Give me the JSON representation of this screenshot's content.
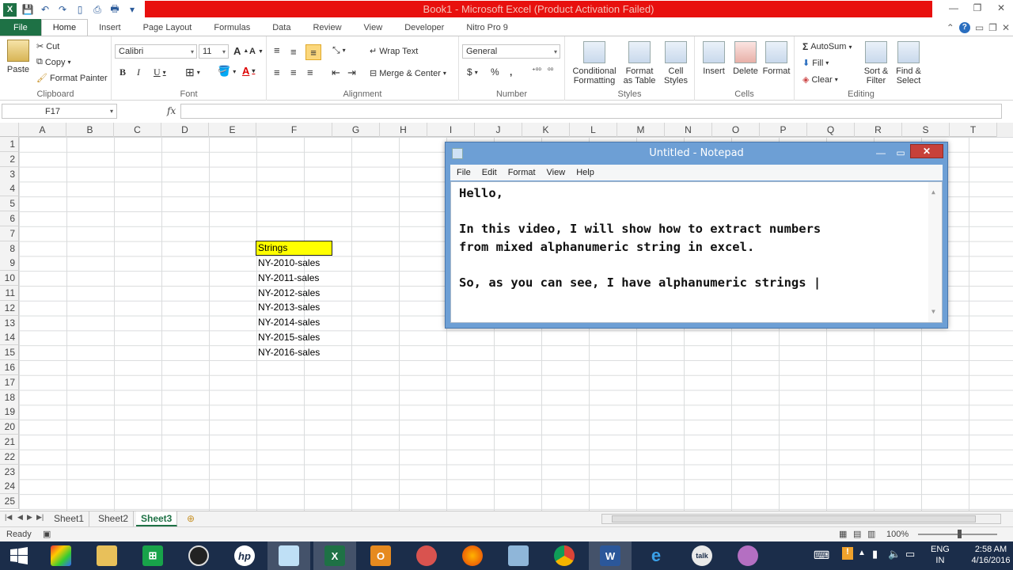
{
  "window": {
    "title": "Book1 - Microsoft Excel (Product Activation Failed)"
  },
  "ribbon_tabs": [
    "File",
    "Home",
    "Insert",
    "Page Layout",
    "Formulas",
    "Data",
    "Review",
    "View",
    "Developer",
    "Nitro Pro 9"
  ],
  "clipboard": {
    "paste": "Paste",
    "cut": "Cut",
    "copy": "Copy",
    "format_painter": "Format Painter",
    "label": "Clipboard"
  },
  "font": {
    "name": "Calibri",
    "size": "11",
    "label": "Font"
  },
  "alignment": {
    "wrap_text": "Wrap Text",
    "merge_center": "Merge & Center",
    "label": "Alignment"
  },
  "number": {
    "format": "General",
    "label": "Number"
  },
  "styles": {
    "conditional": [
      "Conditional",
      "Formatting"
    ],
    "format_table": [
      "Format",
      "as Table"
    ],
    "cell_styles": [
      "Cell",
      "Styles"
    ],
    "label": "Styles"
  },
  "cells_group": {
    "insert": "Insert",
    "delete": "Delete",
    "format": "Format",
    "label": "Cells"
  },
  "editing": {
    "autosum": "AutoSum",
    "fill": "Fill",
    "clear": "Clear",
    "sort_filter": [
      "Sort &",
      "Filter"
    ],
    "find_select": [
      "Find &",
      "Select"
    ],
    "label": "Editing"
  },
  "formula_bar": {
    "name_box": "F17",
    "fx": "fx",
    "value": ""
  },
  "columns": [
    "A",
    "B",
    "C",
    "D",
    "E",
    "F",
    "G",
    "H",
    "I",
    "J",
    "K",
    "L",
    "M",
    "N",
    "O",
    "P",
    "Q",
    "R",
    "S",
    "T"
  ],
  "rows": [
    "1",
    "2",
    "3",
    "4",
    "5",
    "6",
    "7",
    "8",
    "9",
    "10",
    "11",
    "12",
    "13",
    "14",
    "15",
    "16",
    "17",
    "18",
    "19",
    "20",
    "21",
    "22",
    "23",
    "24",
    "25"
  ],
  "sheet": {
    "header_cell": "Strings",
    "values": [
      "NY-2010-sales",
      "NY-2011-sales",
      "NY-2012-sales",
      "NY-2013-sales",
      "NY-2014-sales",
      "NY-2015-sales",
      "NY-2016-sales"
    ]
  },
  "sheet_tabs": [
    "Sheet1",
    "Sheet2",
    "Sheet3"
  ],
  "active_sheet": "Sheet3",
  "status": {
    "ready": "Ready",
    "zoom": "100%"
  },
  "notepad": {
    "title": "Untitled - Notepad",
    "menu": [
      "File",
      "Edit",
      "Format",
      "View",
      "Help"
    ],
    "lines": [
      "Hello,",
      "",
      "In this video, I will show how to extract numbers",
      "from mixed alphanumeric string in excel.",
      "",
      "So, as you can see, I have alphanumeric strings |"
    ]
  },
  "taskbar": {
    "language": [
      "ENG",
      "IN"
    ],
    "time": "2:58 AM",
    "date": "4/16/2016"
  },
  "colors": {
    "excel_green": "#1e7145",
    "title_alert": "#e8100e",
    "highlight_yellow": "#ffff00",
    "notepad_frame": "#6d9fd5",
    "taskbar": "#1b2d4a"
  }
}
